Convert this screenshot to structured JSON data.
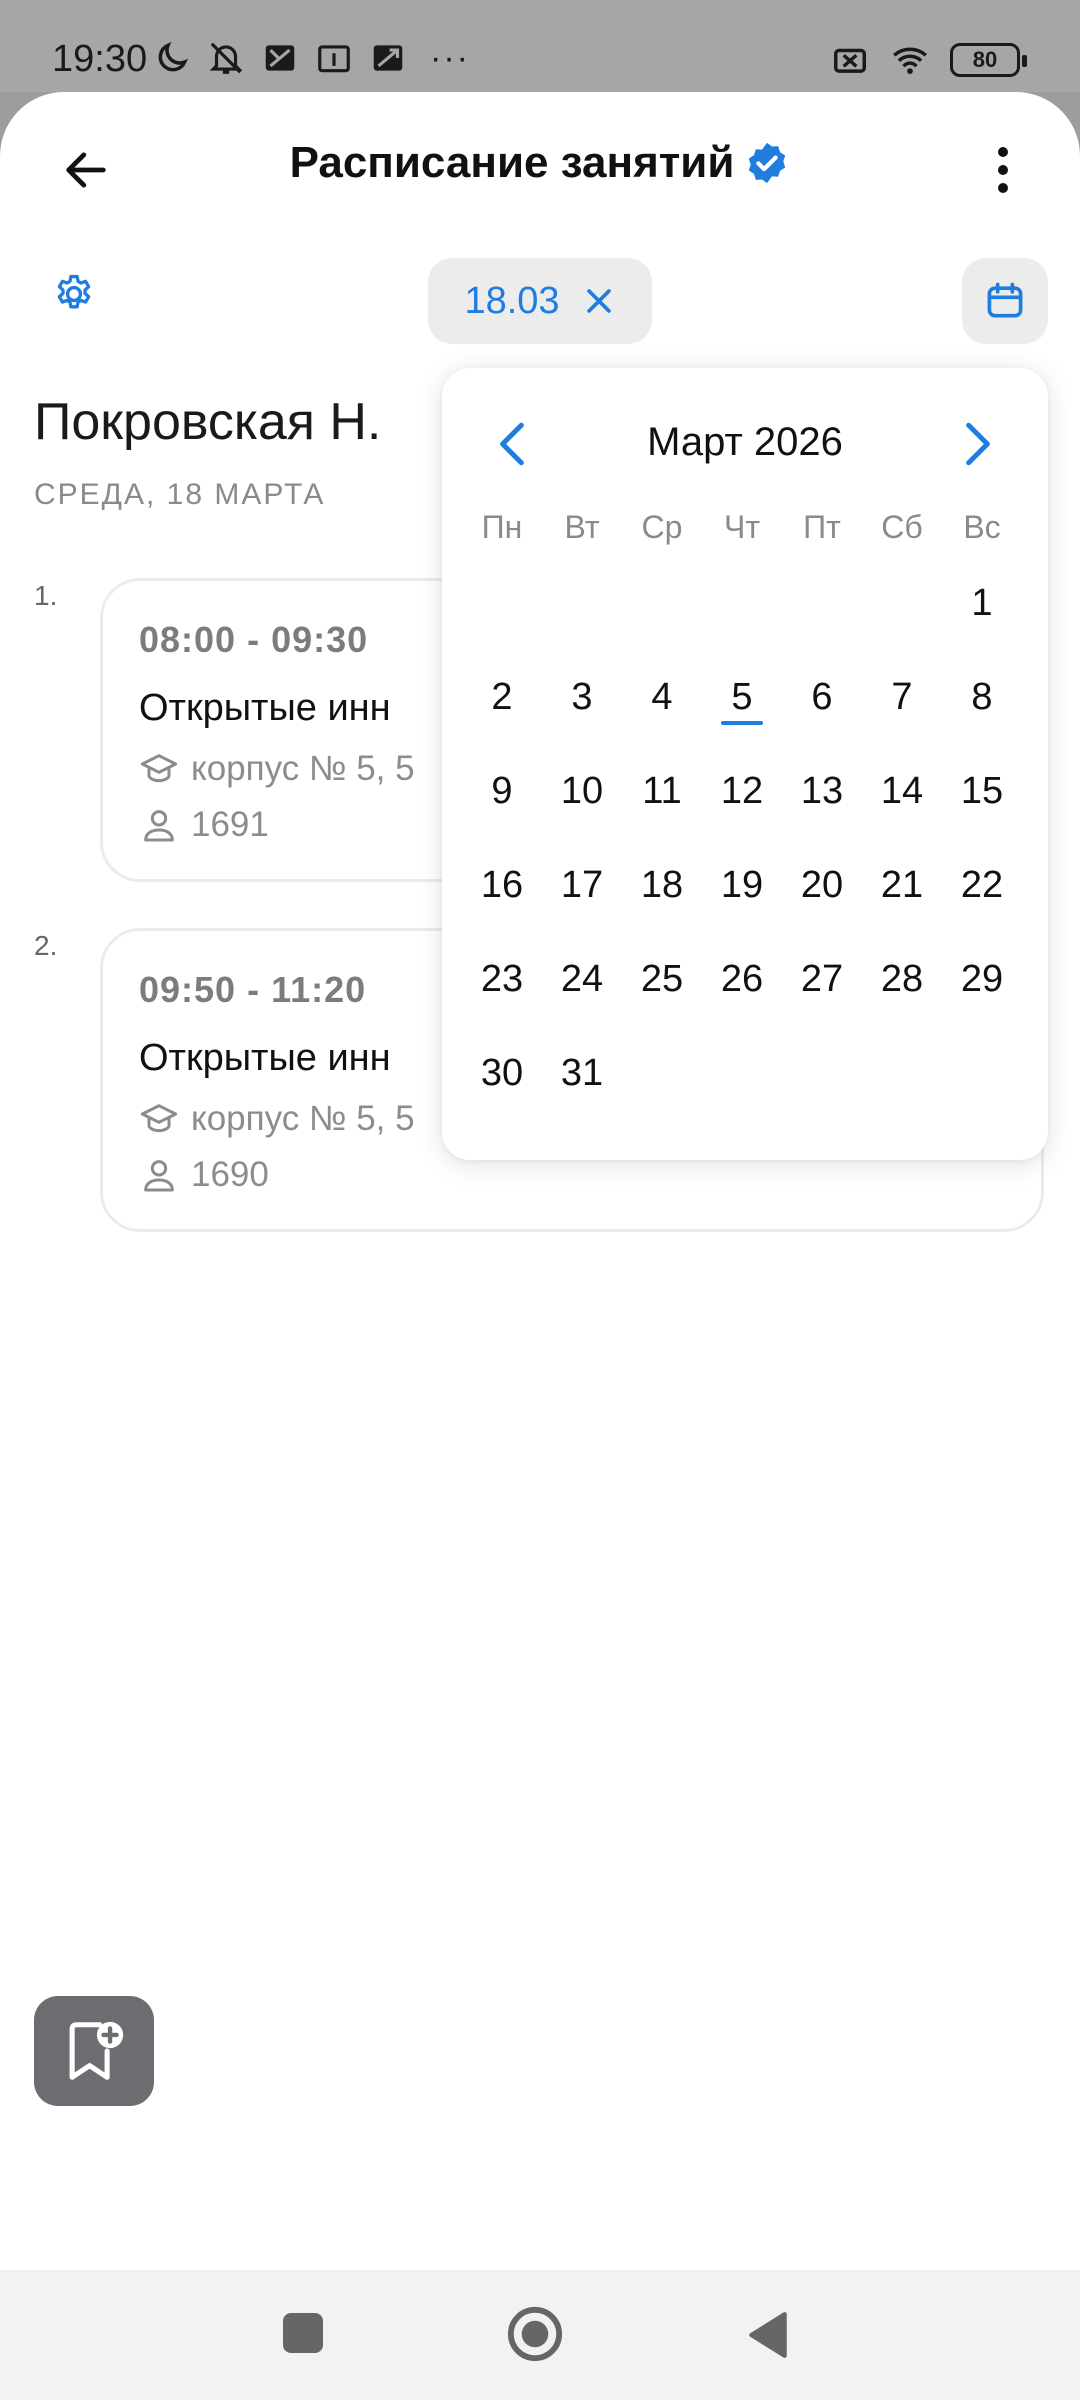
{
  "status_bar": {
    "time": "19:30",
    "icons_left": [
      "moon-icon",
      "muted-bell-icon",
      "app-icon-1",
      "calendar-1-icon",
      "app-icon-2"
    ],
    "overflow": "···",
    "battery": "80"
  },
  "header": {
    "title": "Расписание занятий",
    "verified": true
  },
  "filter": {
    "date_chip": "18.03"
  },
  "teacher": {
    "name": "Покровская Н.",
    "day": "СРЕДА, 18 МАРТА"
  },
  "lessons": [
    {
      "number": "1.",
      "time": "08:00 - 09:30",
      "title": "Открытые инн",
      "room": "корпус № 5, 5",
      "group": "1691"
    },
    {
      "number": "2.",
      "time": "09:50 - 11:20",
      "title": "Открытые инн",
      "room": "корпус № 5, 5",
      "group": "1690"
    }
  ],
  "calendar": {
    "month_label": "Март 2026",
    "weekdays": [
      "Пн",
      "Вт",
      "Ср",
      "Чт",
      "Пт",
      "Сб",
      "Вс"
    ],
    "weeks": [
      [
        "",
        "",
        "",
        "",
        "",
        "",
        "1"
      ],
      [
        "2",
        "3",
        "4",
        "5",
        "6",
        "7",
        "8"
      ],
      [
        "9",
        "10",
        "11",
        "12",
        "13",
        "14",
        "15"
      ],
      [
        "16",
        "17",
        "18",
        "19",
        "20",
        "21",
        "22"
      ],
      [
        "23",
        "24",
        "25",
        "26",
        "27",
        "28",
        "29"
      ],
      [
        "30",
        "31",
        "",
        "",
        "",
        "",
        ""
      ]
    ],
    "today": "5"
  },
  "colors": {
    "accent": "#1f7de0",
    "chip_bg": "#ececec",
    "muted_text": "#8a8a8a"
  }
}
